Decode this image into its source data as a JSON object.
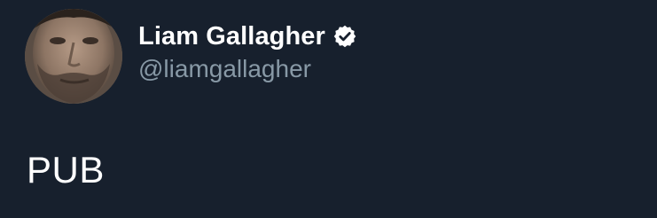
{
  "tweet": {
    "author": {
      "display_name": "Liam Gallagher",
      "handle": "@liamgallagher",
      "verified": true,
      "avatar_icon": "profile-photo"
    },
    "text": "PUB"
  },
  "theme": {
    "background": "#17202d",
    "name_color": "#ffffff",
    "handle_color": "#8899a6",
    "text_color": "#ffffff",
    "badge_fill": "#ffffff",
    "badge_check": "#17202d"
  }
}
